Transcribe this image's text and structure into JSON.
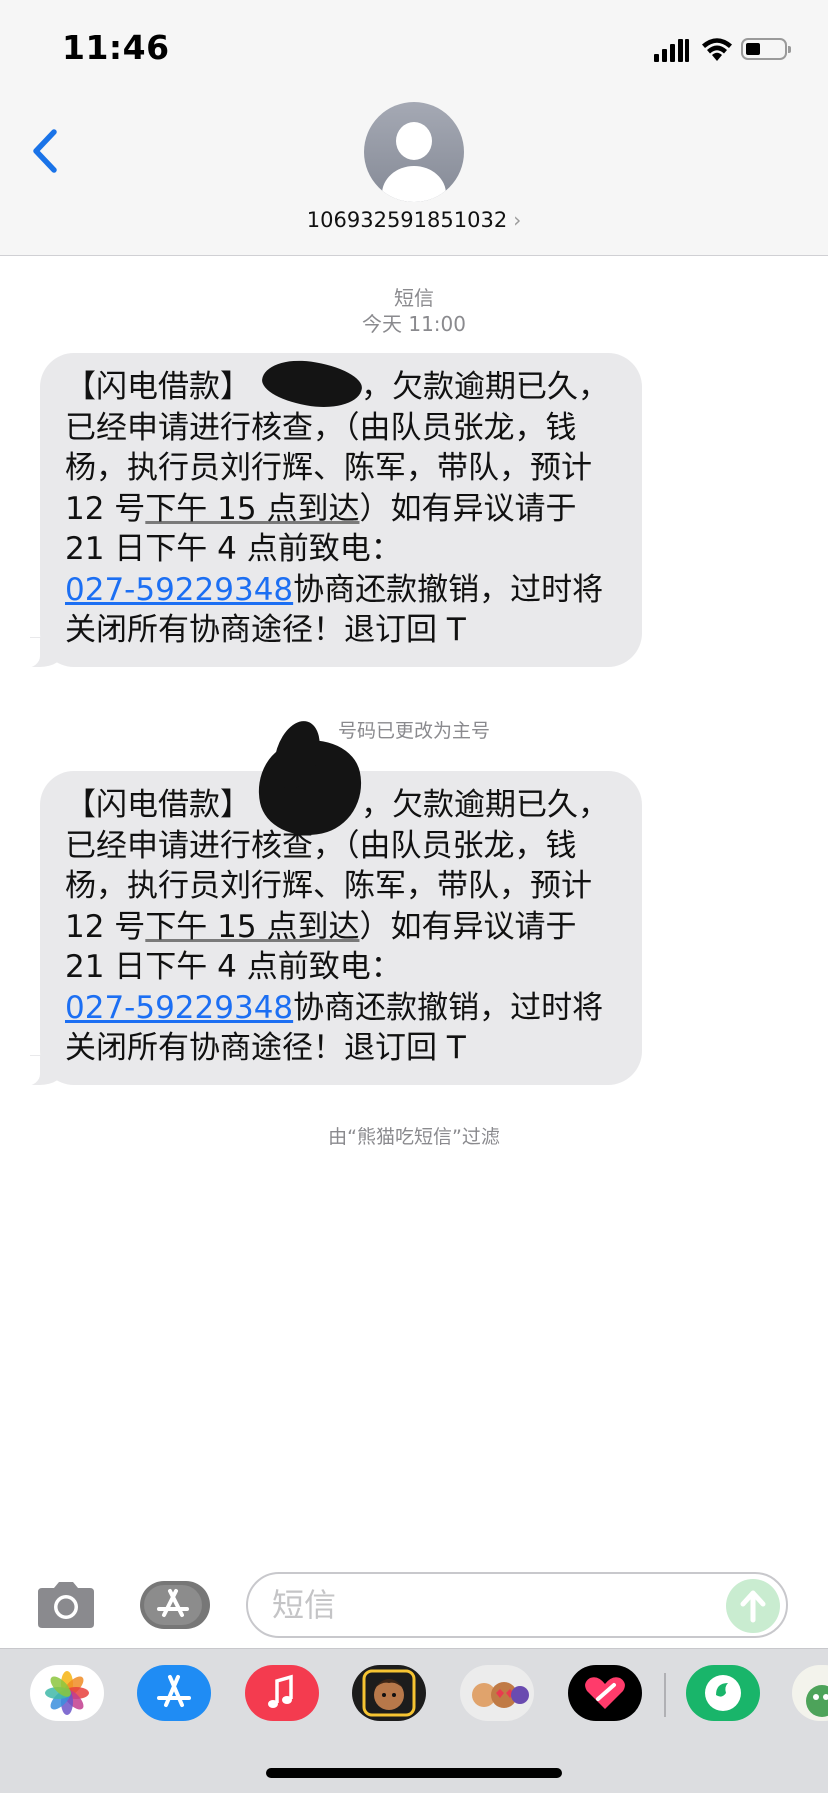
{
  "status_bar": {
    "time": "11:46"
  },
  "header": {
    "contact_number": "106932591851032",
    "chevron": "›"
  },
  "conversation": {
    "service_label": "短信",
    "date_label": "今天 11:00",
    "messages": [
      {
        "part1": "【闪电借款】",
        "part2": "，欠款逾期已久，已经申请进行核查，（由队员张龙，钱杨，执行员刘行辉、陈军，带队，预计 12 号",
        "date_detected": "下午 15 点到达",
        "part3": "）如有异议请于 21 日下午 4 点前致电：",
        "phone": "027-59229348",
        "part4": "协商还款撤销，过时将关闭所有协商途径！退订回 T"
      },
      {
        "part1": "【闪电借款】",
        "part2": "，欠款逾期已久，已经申请进行核查，（由队员张龙，钱杨，执行员刘行辉、陈军，带队，预计 12 号",
        "date_detected": "下午 15 点到达",
        "part3": "）如有异议请于 21 日下午 4 点前致电：",
        "phone": "027-59229348",
        "part4": "协商还款撤销，过时将关闭所有协商途径！退订回 T"
      }
    ],
    "number_changed_notice": "号码已更改为主号",
    "filter_notice": "由“熊猫吃短信”过滤"
  },
  "compose": {
    "placeholder": "短信"
  },
  "app_drawer": {
    "icons": [
      "photos-icon",
      "app-store-icon",
      "music-icon",
      "memoji-icon",
      "memoji-stickers-icon",
      "digital-touch-icon",
      "green-app-icon",
      "sticker-app-icon"
    ]
  },
  "colors": {
    "link": "#1c6ff3",
    "bubble": "#e9e9eb",
    "back": "#1a73e8",
    "send": "#c9ecd0"
  }
}
